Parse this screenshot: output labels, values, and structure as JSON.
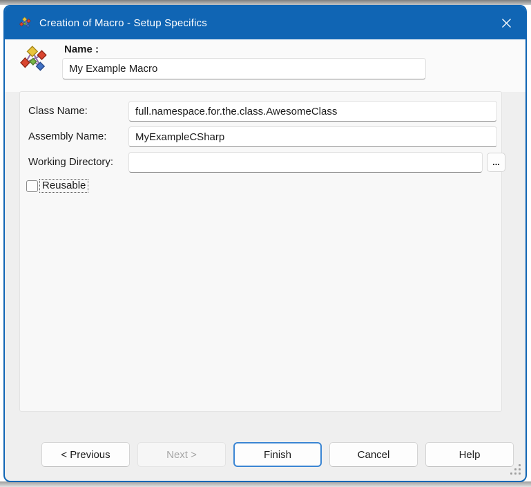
{
  "window": {
    "title": "Creation of Macro - Setup Specifics"
  },
  "header": {
    "name_label": "Name :",
    "name_value": "My Example Macro"
  },
  "form": {
    "class_name": {
      "label": "Class Name:",
      "value": "full.namespace.for.the.class.AwesomeClass"
    },
    "assembly_name": {
      "label": "Assembly Name:",
      "value": "MyExampleCSharp"
    },
    "working_directory": {
      "label": "Working Directory:",
      "value": "",
      "browse_label": "..."
    },
    "reusable": {
      "label": "Reusable",
      "checked": false
    }
  },
  "buttons": {
    "previous": "< Previous",
    "next": "Next >",
    "finish": "Finish",
    "cancel": "Cancel",
    "help": "Help"
  },
  "colors": {
    "titlebar_blue": "#1065b4",
    "dialog_border_blue": "#1065b4",
    "default_button_border": "#3a85d3",
    "body_gray": "#efefef",
    "panel_bg": "#f8f8f8"
  }
}
